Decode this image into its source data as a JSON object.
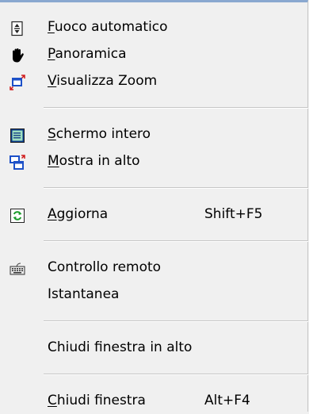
{
  "menu": {
    "groups": [
      [
        {
          "mnemonic": "F",
          "rest": "uoco automatico",
          "icon": "focus-updown-icon"
        },
        {
          "mnemonic": "P",
          "rest": "anoramica",
          "icon": "hand-pan-icon"
        },
        {
          "mnemonic": "V",
          "rest": "isualizza Zoom",
          "icon": "zoom-view-icon"
        }
      ],
      [
        {
          "mnemonic": "S",
          "rest": "chermo intero",
          "icon": "fullscreen-icon"
        },
        {
          "mnemonic": "M",
          "rest": "ostra in alto",
          "icon": "show-on-top-icon"
        }
      ],
      [
        {
          "mnemonic": "A",
          "rest": "ggiorna",
          "shortcut": "Shift+F5",
          "icon": "refresh-icon"
        }
      ],
      [
        {
          "mnemonic": "",
          "rest": "Controllo remoto",
          "icon": "keyboard-icon"
        },
        {
          "mnemonic": "",
          "rest": "Istantanea",
          "icon": ""
        }
      ],
      [
        {
          "mnemonic": "",
          "rest": "Chiudi finestra in alto",
          "icon": ""
        }
      ],
      [
        {
          "mnemonic": "C",
          "rest": "hiudi finestra",
          "shortcut": "Alt+F4",
          "icon": ""
        }
      ]
    ]
  }
}
